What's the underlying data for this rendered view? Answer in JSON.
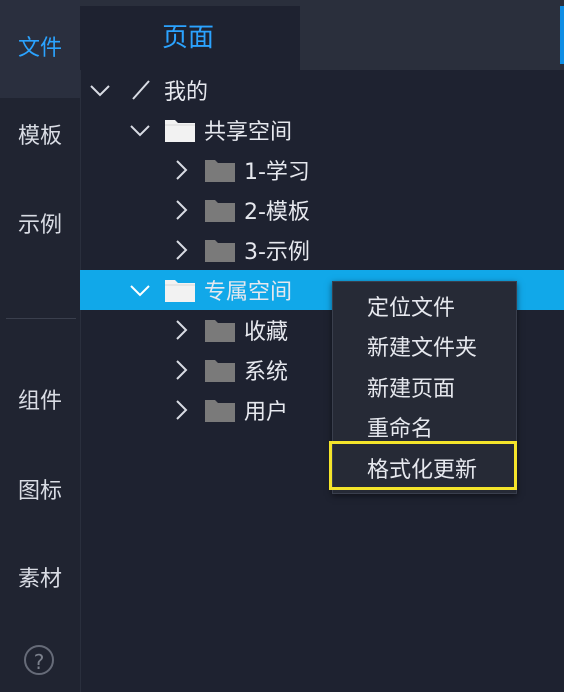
{
  "rail": {
    "items": [
      {
        "label": "文件",
        "active": true
      },
      {
        "label": "模板",
        "active": false
      },
      {
        "label": "示例",
        "active": false
      },
      {
        "label": "组件",
        "active": false
      },
      {
        "label": "图标",
        "active": false
      },
      {
        "label": "素材",
        "active": false
      }
    ],
    "help_icon": "?"
  },
  "tabs": {
    "active_label": "页面"
  },
  "tree": {
    "root": {
      "label": "我的",
      "expanded": true
    },
    "shared": {
      "label": "共享空间",
      "expanded": true,
      "children": [
        {
          "label": "1-学习"
        },
        {
          "label": "2-模板"
        },
        {
          "label": "3-示例"
        }
      ]
    },
    "private": {
      "label": "专属空间",
      "expanded": true,
      "selected": true,
      "children": [
        {
          "label": "收藏"
        },
        {
          "label": "系统"
        },
        {
          "label": "用户"
        }
      ]
    }
  },
  "context_menu": {
    "items": [
      {
        "label": "定位文件"
      },
      {
        "label": "新建文件夹"
      },
      {
        "label": "新建页面"
      },
      {
        "label": "重命名"
      },
      {
        "label": "格式化更新",
        "highlighted": true
      }
    ]
  },
  "colors": {
    "accent": "#2ba3ff",
    "selection": "#11a8e9",
    "highlight_border": "#f4e42b",
    "folder": "#7a7a7a",
    "folder_light": "#f2f2f2"
  }
}
